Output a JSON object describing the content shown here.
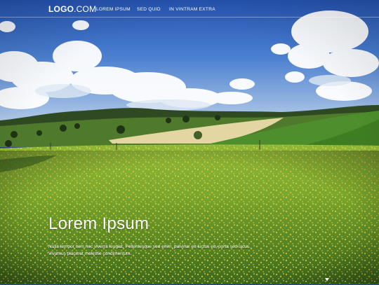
{
  "header": {
    "logo_bold": "LOGO",
    "logo_light": ".COM",
    "nav": [
      {
        "label": "LOREM IPSUM"
      },
      {
        "label": "SED QUID"
      },
      {
        "label": "IN VINTRAM EXTRA"
      }
    ]
  },
  "hero": {
    "title": "Lorem Ipsum",
    "text": "Nulla tempor sem nec viverra feugiat. Pellentesque sed enim, pulvinar eu luctus eu, porta sed lacus. Vivamus placerat molestie condimentum."
  },
  "scroll_icon": "down-arrow-icon",
  "colors": {
    "sky_top": "#2c5bb8",
    "sky_horizon": "#a9c4e8",
    "field_green": "#5f9a2e",
    "flower_yellow": "#d8c63a"
  }
}
